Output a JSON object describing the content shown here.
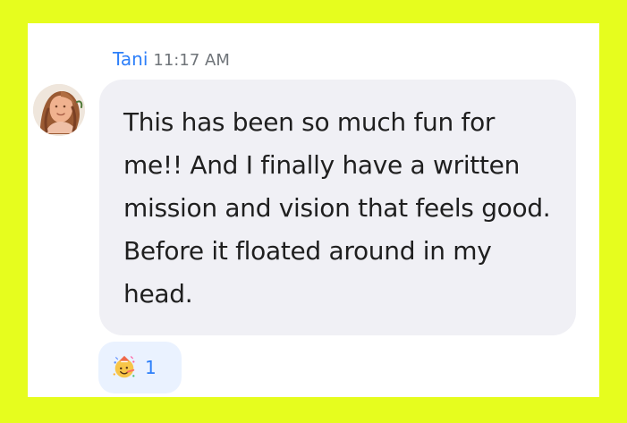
{
  "message": {
    "sender": "Tani",
    "time": "11:17 AM",
    "text": "This has been so much fun for me!! And I finally have a written mission and vision that feels good. Before it floated around in my head."
  },
  "reaction": {
    "icon": "party-face-icon",
    "count": "1"
  },
  "colors": {
    "background": "#e6fd1e",
    "card": "#ffffff",
    "sender": "#2d7ff9",
    "time": "#6f7479",
    "bubble": "#f0f0f5",
    "reaction_bg": "#eaf2ff",
    "reaction_count": "#2d7ff9"
  }
}
